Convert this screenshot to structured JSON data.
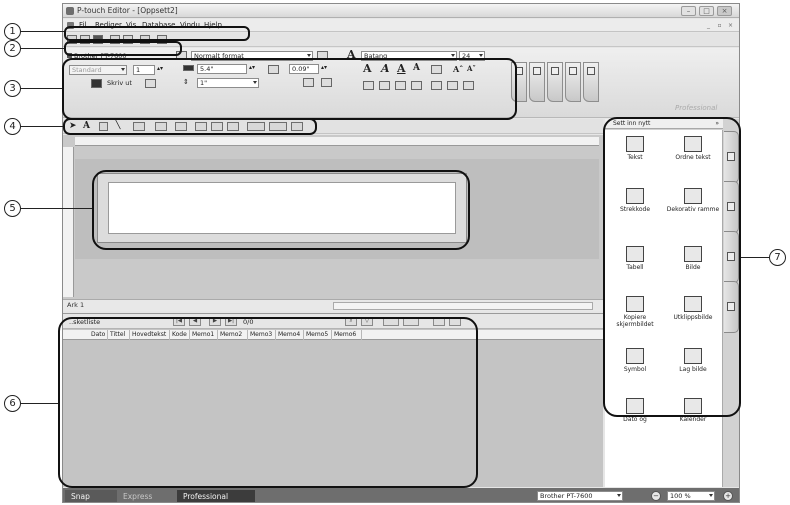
{
  "window": {
    "title": "P-touch Editor - [Oppsett2]"
  },
  "menubar": {
    "items": [
      "Fil",
      "Rediger",
      "Vis",
      "Database",
      "Vindu",
      "Hjelp"
    ]
  },
  "properties": {
    "printer_name": "Brother PT-7600",
    "quality": "Standard",
    "copies": "1",
    "print_button": "Skriv ut",
    "format": "Normalt format",
    "length": "5.4\"",
    "margin": "0.09\"",
    "height": "1\"",
    "font": "Batang",
    "font_size": "24",
    "brand_watermark": "Professional"
  },
  "layout": {
    "sheet_tab": "Ark 1"
  },
  "database": {
    "title": "..sketliste",
    "record_count": "0/0",
    "columns": [
      "Dato",
      "Tittel",
      "Hovedtekst",
      "Kode",
      "Memo1",
      "Memo2",
      "Memo3",
      "Memo4",
      "Memo5",
      "Memo6"
    ]
  },
  "sidepanel": {
    "header": "Sett inn nytt",
    "collapse": "»",
    "items": [
      {
        "label": "Tekst",
        "icon": "text-icon"
      },
      {
        "label": "Ordne tekst",
        "icon": "arrange-text-icon"
      },
      {
        "label": "Strekkode",
        "icon": "barcode-icon"
      },
      {
        "label": "Dekorativ ramme",
        "icon": "frame-icon"
      },
      {
        "label": "Tabell",
        "icon": "table-icon"
      },
      {
        "label": "Bilde",
        "icon": "image-icon"
      },
      {
        "label": "Kopiere skjermbildet",
        "icon": "screen-capture-icon"
      },
      {
        "label": "Utklippsbilde",
        "icon": "clip-art-icon"
      },
      {
        "label": "Symbol",
        "icon": "symbol-icon"
      },
      {
        "label": "Lag bilde",
        "icon": "make-image-icon"
      },
      {
        "label": "Dato og",
        "icon": "date-time-icon"
      },
      {
        "label": "Kalender",
        "icon": "calendar-icon"
      }
    ]
  },
  "modebar": {
    "tabs": [
      "Snap",
      "Express",
      "Professional"
    ],
    "printer": "Brother PT-7600",
    "zoom": "100 %"
  },
  "callouts": [
    "1",
    "2",
    "3",
    "4",
    "5",
    "6",
    "7"
  ],
  "colors": {
    "modebar_bg": "#6e6e6e",
    "active_tab": "#3c3c3c",
    "callout_line": "#111111"
  }
}
